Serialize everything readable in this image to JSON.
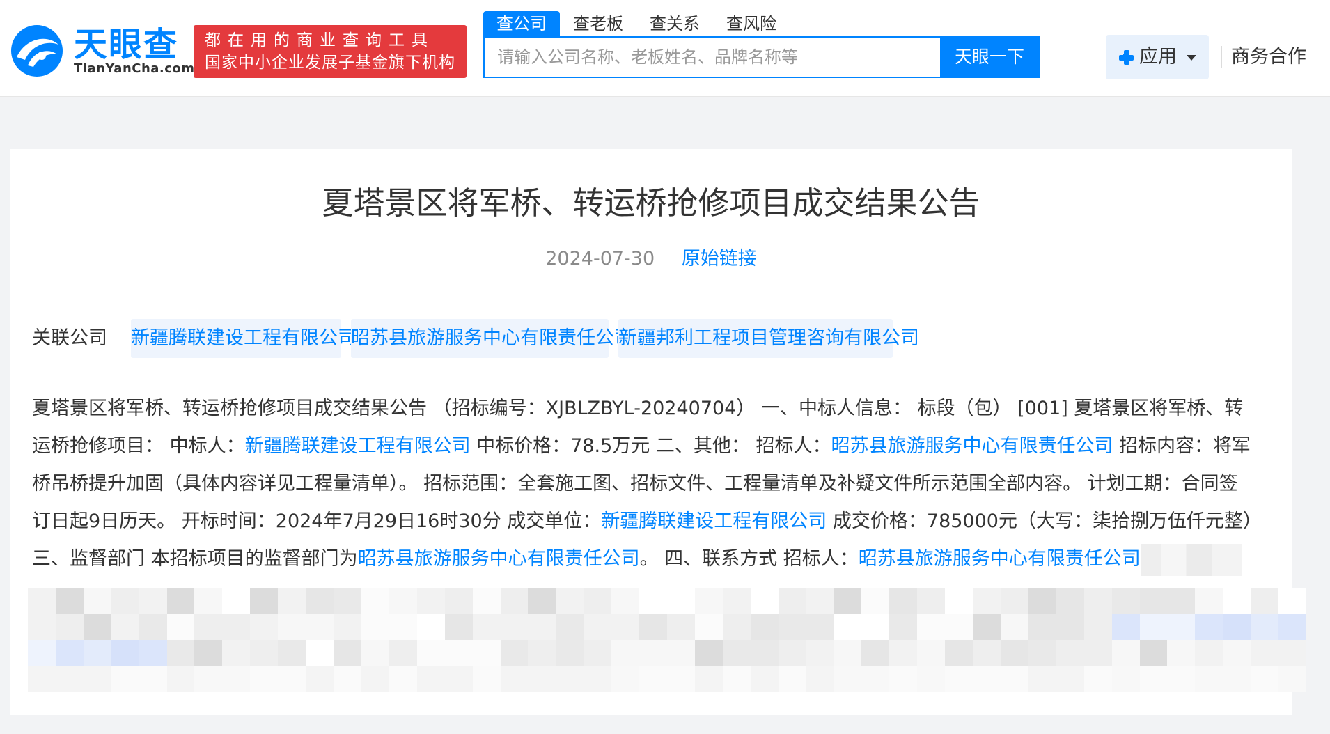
{
  "header": {
    "logo": {
      "cn": "天眼查",
      "en": "TianYanCha.com",
      "brand_color": "#0084ff"
    },
    "slogan": {
      "line1": "都在用的商业查询工具",
      "line2": "国家中小企业发展子基金旗下机构",
      "bg_color": "#e43a3d"
    },
    "search": {
      "tabs": [
        "查公司",
        "查老板",
        "查关系",
        "查风险"
      ],
      "active_tab": 0,
      "placeholder": "请输入公司名称、老板姓名、品牌名称等",
      "button": "天眼一下"
    },
    "apps_button": {
      "label": "应用",
      "icon": "app-grid-icon"
    },
    "business_link": "商务合作"
  },
  "article": {
    "title": "夏塔景区将军桥、转运桥抢修项目成交结果公告",
    "date": "2024-07-30",
    "original_link": "原始链接",
    "related_label": "关联公司",
    "related_companies": [
      "新疆腾联建设工程有限公司",
      "昭苏县旅游服务中心有限责任公司",
      "新疆邦利工程项目管理咨询有限公司"
    ],
    "body": {
      "l1": "夏塔景区将军桥、转运桥抢修项目成交结果公告 （招标编号：XJBLZBYL-20240704） 一、中标人信息： 标段（包） [001] 夏塔景区将军桥、转",
      "l2a": "运桥抢修项目： 中标人：",
      "l2b": "新疆腾联建设工程有限公司",
      "l2c": " 中标价格：78.5万元 二、其他： 招标人：",
      "l2d": "昭苏县旅游服务中心有限责任公司",
      "l2e": " 招标内容：将军",
      "l3": "桥吊桥提升加固（具体内容详见工程量清单）。 招标范围：全套施工图、招标文件、工程量清单及补疑文件所示范围全部内容。 计划工期：合同签",
      "l4a": "订日起9日历天。 开标时间：2024年7月29日16时30分 成交单位：",
      "l4b": "新疆腾联建设工程有限公司",
      "l4c": " 成交价格：785000元（大写：柒拾捌万伍仟元整）",
      "l5a": "三、监督部门 本招标项目的监督部门为",
      "l5b": "昭苏县旅游服务中心有限责任公司",
      "l5c": "。 四、联系方式 招标人：",
      "l5d": "昭苏县旅游服务中心有限责任公司"
    }
  }
}
